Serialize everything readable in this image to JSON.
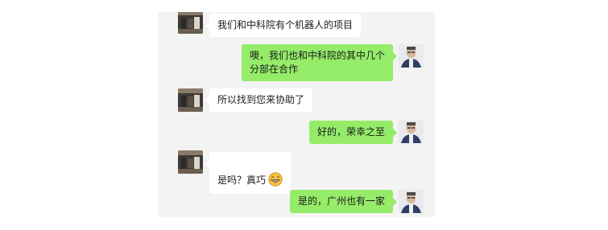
{
  "colors": {
    "chat_background": "#f3f3f3",
    "incoming_bubble": "#ffffff",
    "outgoing_bubble": "#95ec69"
  },
  "messages": [
    {
      "sender": "other",
      "text": "我们和中科院有个机器人的项目"
    },
    {
      "sender": "self",
      "text": "噢，我们也和中科院的其中几个\n分部在合作"
    },
    {
      "sender": "other",
      "text": "所以找到您来协助了"
    },
    {
      "sender": "self",
      "text": "好的，荣幸之至"
    },
    {
      "sender": "other",
      "text": "是吗？真巧",
      "emoji": "grin-face-icon"
    },
    {
      "sender": "self",
      "text": "是的，广州也有一家"
    }
  ]
}
